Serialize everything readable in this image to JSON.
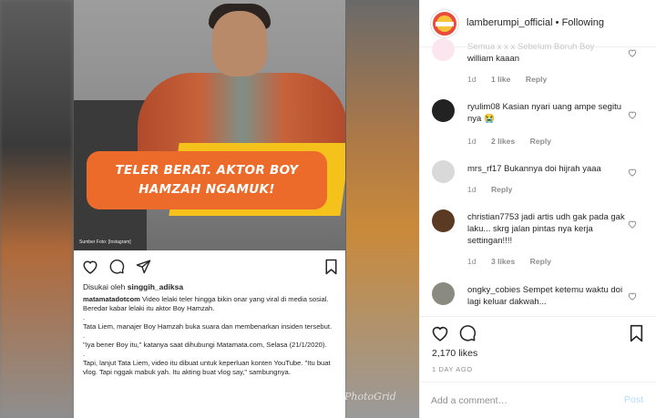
{
  "post_image": {
    "headline": "TELER BERAT. AKTOR BOY HAMZAH NGAMUK!",
    "credit": "Sumber Foto: [Instagram]"
  },
  "left_post": {
    "liked_by_prefix": "Disukai oleh",
    "liked_by_user": "singgih_adiksa",
    "caption_user": "matamatadotcom",
    "caption_lines": [
      " Video lelaki teler hingga bikin onar yang viral di media sosial. Beredar kabar lelaki itu aktor Boy Hamzah.",
      ".",
      "Tata Liem, manajer Boy Hamzah buka suara dan membenarkan insiden tersebut.",
      ".",
      "\"Iya bener Boy itu,\" katanya saat dihubungi Matamata.com, Selasa (21/1/2020).",
      ".",
      "Tapi, lanjut Tata Liem, video itu dibuat untuk keperluan konten YouTube. \"Itu buat vlog. Tapi nggak mabuk yah. Itu akting buat vlog say,\" sambungnya."
    ]
  },
  "watermark": "PhotoGrid",
  "header": {
    "username": "lamberumpi_official",
    "separator": "•",
    "follow_state": "Following"
  },
  "comments": [
    {
      "user": "",
      "text": "william kaaan",
      "pre_text": "Semua x x x Sebelum Boruh Boy",
      "time": "1d",
      "likes": "1 like",
      "reply": "Reply"
    },
    {
      "user": "ryulim08",
      "text": "Kasian nyari uang ampe segitu nya 😭",
      "time": "1d",
      "likes": "2 likes",
      "reply": "Reply"
    },
    {
      "user": "mrs_rf17",
      "text": "Bukannya doi hijrah yaaa",
      "time": "1d",
      "likes": "",
      "reply": "Reply"
    },
    {
      "user": "christian7753",
      "text": "jadi artis udh gak pada gak laku... skrg jalan pintas nya kerja settingan!!!!",
      "time": "1d",
      "likes": "3 likes",
      "reply": "Reply"
    },
    {
      "user": "ongky_cobies",
      "text": "Sempet ketemu waktu doi lagi keluar dakwah...",
      "time": "",
      "likes": "",
      "reply": ""
    }
  ],
  "post_stats": {
    "likes": "2,170 likes",
    "date": "1 DAY AGO"
  },
  "add_comment": {
    "placeholder": "Add a comment…",
    "post_label": "Post"
  },
  "colors": {
    "accent_link": "#b3dbff",
    "banner_orange": "#ec6a2a",
    "banner_yellow": "#f4c21a"
  }
}
